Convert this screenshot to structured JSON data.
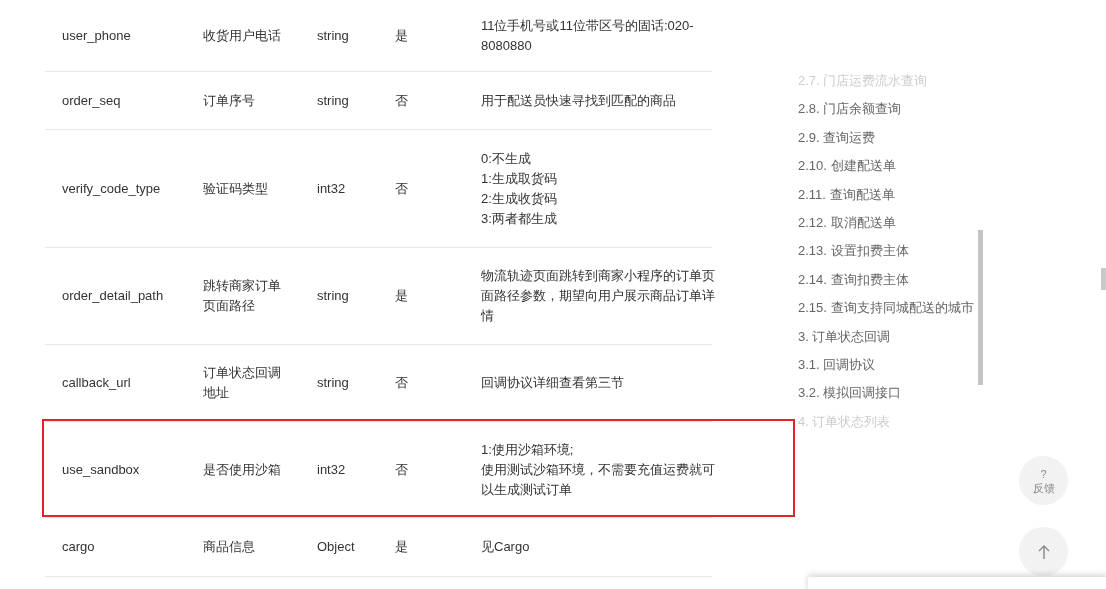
{
  "table": {
    "rows": [
      {
        "name": "user_phone",
        "desc": "收货用户电话",
        "type": "string",
        "required": "是",
        "note": "11位手机号或11位带区号的固话:020-8080880",
        "highlighted": false
      },
      {
        "name": "order_seq",
        "desc": "订单序号",
        "type": "string",
        "required": "否",
        "note": "用于配送员快速寻找到匹配的商品",
        "highlighted": false
      },
      {
        "name": "verify_code_type",
        "desc": "验证码类型",
        "type": "int32",
        "required": "否",
        "note": "0:不生成\n1:生成取货码\n2:生成收货码\n3:两者都生成",
        "highlighted": false
      },
      {
        "name": "order_detail_path",
        "desc": "跳转商家订单页面路径",
        "type": "string",
        "required": "是",
        "note": "物流轨迹页面跳转到商家小程序的订单页面路径参数，期望向用户展示商品订单详情",
        "highlighted": false
      },
      {
        "name": "callback_url",
        "desc": "订单状态回调地址",
        "type": "string",
        "required": "否",
        "note": "回调协议详细查看第三节",
        "highlighted": false
      },
      {
        "name": "use_sandbox",
        "desc": "是否使用沙箱",
        "type": "int32",
        "required": "否",
        "note": "1:使用沙箱环境;\n使用测试沙箱环境，不需要充值运费就可以生成测试订单",
        "highlighted": true
      },
      {
        "name": "cargo",
        "desc": "商品信息",
        "type": "Object",
        "required": "是",
        "note": "见Cargo",
        "highlighted": false
      }
    ]
  },
  "toc": {
    "items": [
      {
        "label": "2.7. 门店运费流水查询",
        "faded": true
      },
      {
        "label": "2.8. 门店余额查询",
        "faded": false
      },
      {
        "label": "2.9. 查询运费",
        "faded": false
      },
      {
        "label": "2.10. 创建配送单",
        "faded": false
      },
      {
        "label": "2.11. 查询配送单",
        "faded": false
      },
      {
        "label": "2.12. 取消配送单",
        "faded": false
      },
      {
        "label": "2.13. 设置扣费主体",
        "faded": false
      },
      {
        "label": "2.14. 查询扣费主体",
        "faded": false
      },
      {
        "label": "2.15. 查询支持同城配送的城市",
        "faded": false
      },
      {
        "label": "3. 订单状态回调",
        "faded": false
      },
      {
        "label": "3.1. 回调协议",
        "faded": false
      },
      {
        "label": "3.2. 模拟回调接口",
        "faded": false
      },
      {
        "label": "4. 订单状态列表",
        "faded": true
      }
    ]
  },
  "feedback_button": {
    "icon": "?",
    "label": "反馈"
  }
}
